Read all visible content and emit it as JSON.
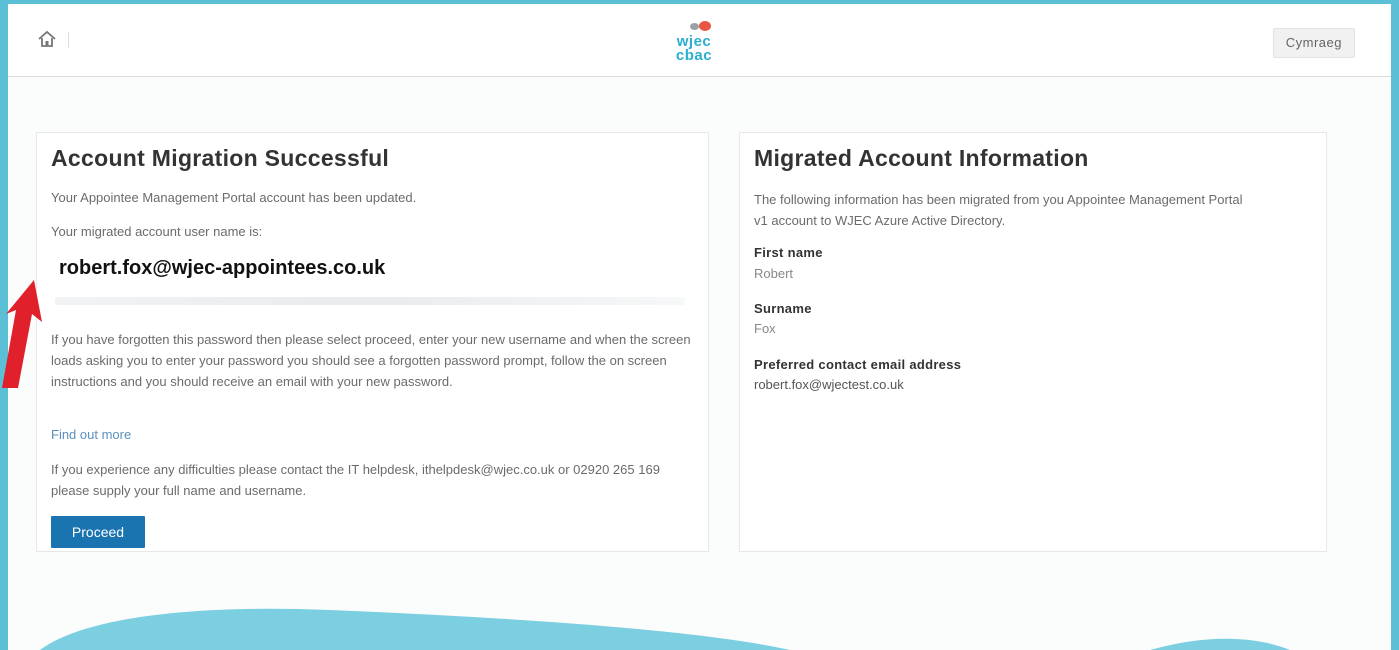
{
  "header": {
    "home_icon": "home-icon",
    "logo_line1": "wjec",
    "logo_line2": "cbac",
    "language_button": "Cymraeg"
  },
  "left_card": {
    "title": "Account Migration Successful",
    "updated_text": "Your Appointee Management Portal account has been updated.",
    "username_intro": "Your migrated account user name is:",
    "username": "robert.fox@wjec-appointees.co.uk",
    "forgot_password_text": "If you have forgotten this password then please select proceed, enter your new username and when the screen loads asking you to enter your password you should see a forgotten password prompt, follow the on screen instructions and you should receive an email with your new password.",
    "find_out_more": "Find out more",
    "difficulties_text": "If you experience any difficulties please contact the IT helpdesk, ithelpdesk@wjec.co.uk or 02920 265 169 please supply your full name and username.",
    "proceed_button": "Proceed"
  },
  "right_card": {
    "title": "Migrated Account Information",
    "intro": "The following information has been migrated from you Appointee Management Portal v1 account to WJEC Azure Active Directory.",
    "fields": [
      {
        "label": "First name",
        "value": "Robert"
      },
      {
        "label": "Surname",
        "value": "Fox"
      },
      {
        "label": "Preferred contact email address",
        "value": "robert.fox@wjectest.co.uk"
      }
    ]
  },
  "colors": {
    "accent_border": "#5bc0d6",
    "proceed_button": "#1a74b0",
    "arrow": "#e0202a",
    "wave": "#7ccfe0"
  }
}
